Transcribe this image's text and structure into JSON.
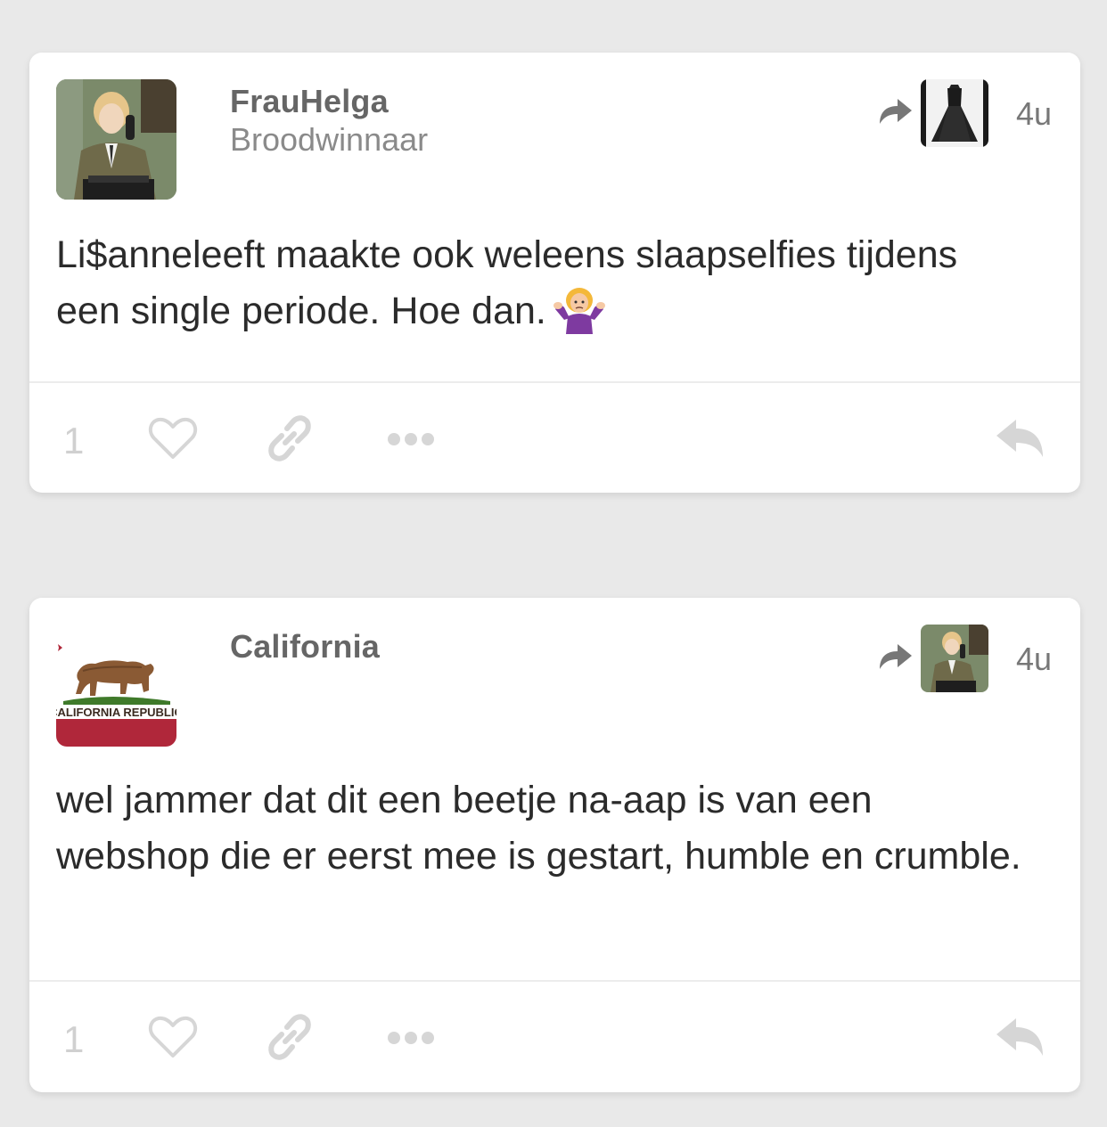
{
  "posts": [
    {
      "username": "FrauHelga",
      "subtitle": "Broodwinnaar",
      "time": "4u",
      "text": "Li$anneleeft maakte ook weleens slaapselfies tijdens een single periode. Hoe dan.",
      "emoji": "woman-shrugging-emoji",
      "like_count": "1"
    },
    {
      "username": "California",
      "subtitle": "",
      "time": "4u",
      "text": "wel jammer dat dit een beetje na-aap is van een webshop die er eerst mee is gestart, humble en crumble.",
      "like_count": "1",
      "avatar_flag_text": "CALIFORNIA REPUBLIC"
    }
  ],
  "colors": {
    "background": "#e9e9e9",
    "card": "#ffffff",
    "icon_muted": "#d6d6d6",
    "flag_red": "#b0273a"
  }
}
